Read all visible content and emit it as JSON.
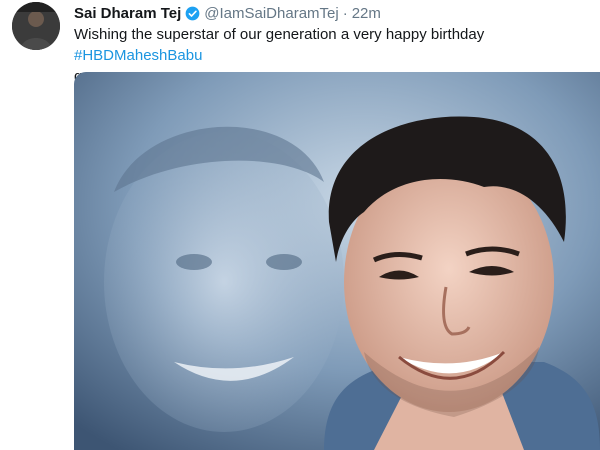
{
  "tweet": {
    "display_name": "Sai Dharam Tej",
    "handle": "@IamSaiDharamTej",
    "separator": "·",
    "time": "22m",
    "text_main": "Wishing the superstar of our generation a very happy birthday ",
    "hashtag": "#HBDMaheshBabu",
    "text_after": "garu",
    "avatar_icon": "profile-avatar",
    "verified_icon": "verified-badge-icon",
    "media_icon": "photo-portrait",
    "colors": {
      "name": "#14171a",
      "meta": "#657786",
      "hashtag": "#1b95e0",
      "verified": "#1da1f2",
      "media_bg": "#6f8aa6"
    }
  }
}
